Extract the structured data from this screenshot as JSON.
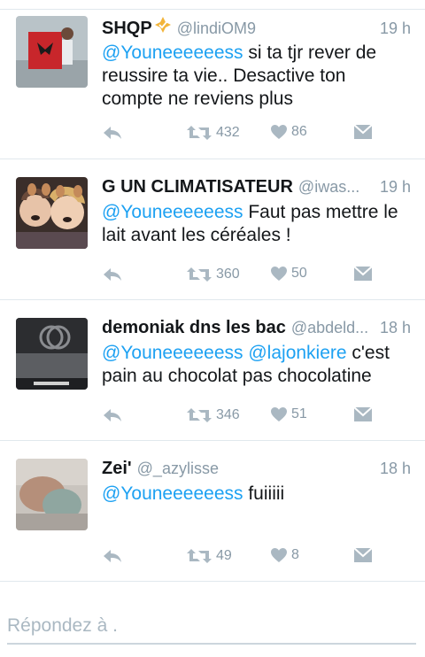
{
  "tweets": [
    {
      "name": "SHQP",
      "handle": "@lindiOM9",
      "time": "19 h",
      "segments": [
        {
          "text": "@Youneeeeeess",
          "mention": true
        },
        {
          "text": " si ta tjr rever de reussire ta vie.. Desactive ton compte ne reviens plus",
          "mention": false
        }
      ],
      "retweets": "432",
      "likes": "86"
    },
    {
      "name": "G UN CLIMATISATEUR",
      "handle": "@iwas...",
      "time": "19 h",
      "segments": [
        {
          "text": "@Youneeeeeess",
          "mention": true
        },
        {
          "text": " Faut pas mettre le lait avant les céréales !",
          "mention": false
        }
      ],
      "retweets": "360",
      "likes": "50"
    },
    {
      "name": "demoniak dns les bac",
      "handle": "@abdeld...",
      "time": "18 h",
      "segments": [
        {
          "text": "@Youneeeeeess",
          "mention": true
        },
        {
          "text": " ",
          "mention": false
        },
        {
          "text": "@lajonkiere",
          "mention": true
        },
        {
          "text": " c'est pain au chocolat pas chocolatine",
          "mention": false
        }
      ],
      "retweets": "346",
      "likes": "51"
    },
    {
      "name": "Zei'",
      "handle": "@_azylisse",
      "time": "18 h",
      "segments": [
        {
          "text": "@Youneeeeeess",
          "mention": true
        },
        {
          "text": " fuiiiii",
          "mention": false
        }
      ],
      "retweets": "49",
      "likes": "8"
    }
  ],
  "reply": {
    "placeholder": "Répondez à ."
  },
  "colors": {
    "mention": "#1da1f2",
    "muted": "#8899a6",
    "text": "#14171a",
    "divider": "#e1e8ed"
  },
  "icons": [
    "reply-icon",
    "retweet-icon",
    "heart-icon",
    "direct-message-icon",
    "verified-badge-icon"
  ]
}
